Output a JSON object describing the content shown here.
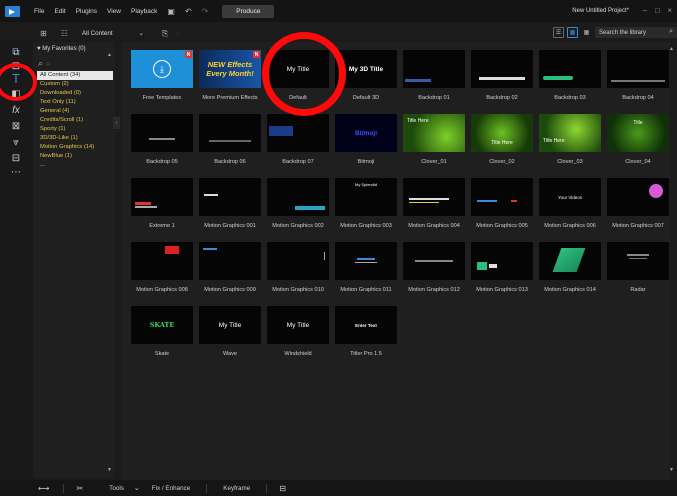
{
  "menubar": {
    "items": [
      "File",
      "Edit",
      "Plugins",
      "View",
      "Playback"
    ],
    "produce_label": "Produce",
    "project_title": "New Untitled Project*"
  },
  "toolbar": {
    "filter_label": "All Content",
    "search_placeholder": "Search the library"
  },
  "sidebar": {
    "favorites": "My Favorites (0)",
    "categories": [
      {
        "label": "All Content (34)",
        "selected": true
      },
      {
        "label": "Custom (2)"
      },
      {
        "label": "Downloaded (0)"
      },
      {
        "label": "Text Only (11)"
      },
      {
        "label": "General (4)"
      },
      {
        "label": "Credits/Scroll (1)"
      },
      {
        "label": "Sporty (1)"
      },
      {
        "label": "3D/3D-Like (1)"
      },
      {
        "label": "Motion Graphics (14)"
      },
      {
        "label": "NewBlue (1)"
      },
      {
        "label": "..."
      }
    ]
  },
  "tiles": [
    {
      "caption": "Free Templates",
      "thumb_text": ""
    },
    {
      "caption": "More Premium Effects",
      "thumb_text": "NEW Effects Every Month!"
    },
    {
      "caption": "Default",
      "thumb_text": "My Title"
    },
    {
      "caption": "Default 3D",
      "thumb_text": "My 3D Title"
    },
    {
      "caption": "Backdrop 01",
      "thumb_text": ""
    },
    {
      "caption": "Backdrop 02",
      "thumb_text": ""
    },
    {
      "caption": "Backdrop 03",
      "thumb_text": ""
    },
    {
      "caption": "Backdrop 04",
      "thumb_text": ""
    },
    {
      "caption": "Backdrop 05",
      "thumb_text": ""
    },
    {
      "caption": "Backdrop 06",
      "thumb_text": ""
    },
    {
      "caption": "Backdrop 07",
      "thumb_text": ""
    },
    {
      "caption": "Bitmoji",
      "thumb_text": "Bitmoji"
    },
    {
      "caption": "Clover_01",
      "thumb_text": "Title Here"
    },
    {
      "caption": "Clover_02",
      "thumb_text": "Title Here"
    },
    {
      "caption": "Clover_03",
      "thumb_text": "Title Here"
    },
    {
      "caption": "Clover_04",
      "thumb_text": "Title"
    },
    {
      "caption": "Extreme 1",
      "thumb_text": ""
    },
    {
      "caption": "Motion Graphics 001",
      "thumb_text": ""
    },
    {
      "caption": "Motion Graphics 002",
      "thumb_text": ""
    },
    {
      "caption": "Motion Graphics 003",
      "thumb_text": "My Splendid"
    },
    {
      "caption": "Motion Graphics 004",
      "thumb_text": ""
    },
    {
      "caption": "Motion Graphics 005",
      "thumb_text": ""
    },
    {
      "caption": "Motion Graphics 006",
      "thumb_text": "Your Videos"
    },
    {
      "caption": "Motion Graphics 007",
      "thumb_text": ""
    },
    {
      "caption": "Motion Graphics 008",
      "thumb_text": ""
    },
    {
      "caption": "Motion Graphics 009",
      "thumb_text": ""
    },
    {
      "caption": "Motion Graphics 010",
      "thumb_text": ""
    },
    {
      "caption": "Motion Graphics 011",
      "thumb_text": ""
    },
    {
      "caption": "Motion Graphics 012",
      "thumb_text": ""
    },
    {
      "caption": "Motion Graphics 013",
      "thumb_text": ""
    },
    {
      "caption": "Motion Graphics 014",
      "thumb_text": ""
    },
    {
      "caption": "Radar",
      "thumb_text": ""
    },
    {
      "caption": "Skate",
      "thumb_text": "SKATE"
    },
    {
      "caption": "Wave",
      "thumb_text": "My Title"
    },
    {
      "caption": "Windshield",
      "thumb_text": "My Title"
    },
    {
      "caption": "Titler Pro 1.5",
      "thumb_text": "Enter Text"
    }
  ],
  "bottombar": {
    "tools_label": "Tools",
    "fix_label": "Fix / Enhance",
    "keyframe_label": "Keyframe"
  }
}
